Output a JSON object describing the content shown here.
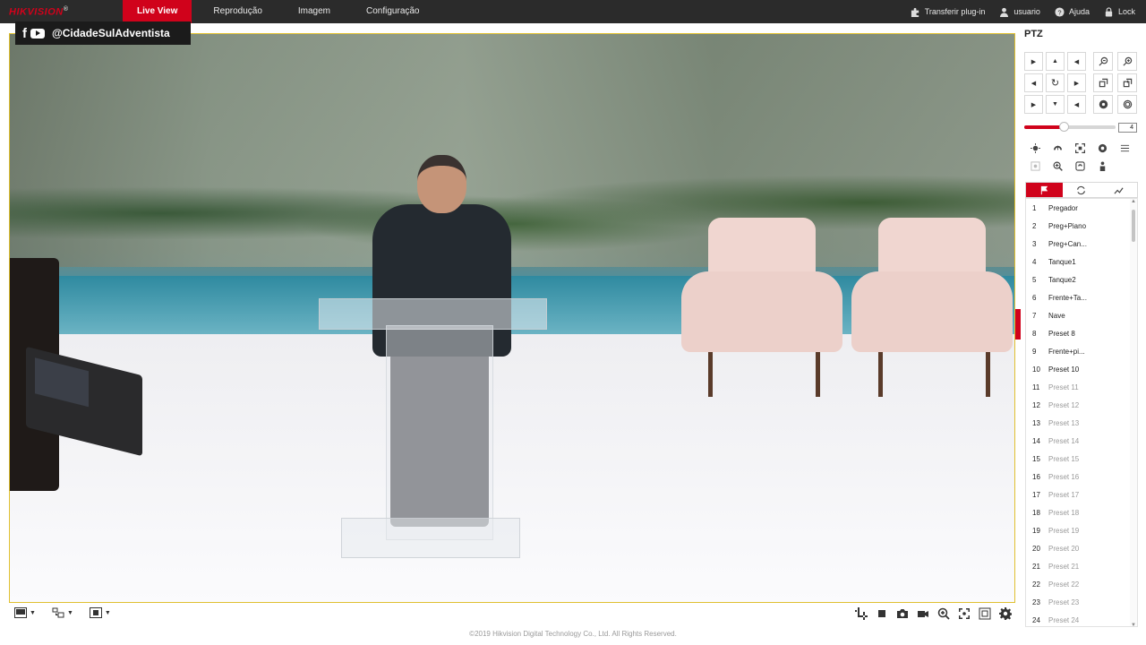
{
  "app": {
    "logo": "HIKVISION",
    "logo_mark": "®"
  },
  "nav": [
    {
      "label": "Live View",
      "active": true
    },
    {
      "label": "Reprodução",
      "active": false
    },
    {
      "label": "Imagem",
      "active": false
    },
    {
      "label": "Configuração",
      "active": false
    }
  ],
  "topbar": {
    "plugin_label": "Transferir plug-in",
    "user_label": "usuario",
    "help_label": "Ajuda",
    "lock_label": "Lock"
  },
  "overlay": {
    "social_handle": "@CidadeSulAdventista",
    "social_icons": [
      "facebook-icon",
      "youtube-icon"
    ]
  },
  "ptz": {
    "title": "PTZ",
    "speed_value": "4",
    "speed_fraction": 0.43,
    "preset_tabs": [
      "preset-flag-icon",
      "patrol-icon",
      "pattern-icon"
    ],
    "presets": [
      {
        "num": "1",
        "name": "Pregador",
        "set": true
      },
      {
        "num": "2",
        "name": "Preg+Piano",
        "set": true
      },
      {
        "num": "3",
        "name": "Preg+Can...",
        "set": true
      },
      {
        "num": "4",
        "name": "Tanque1",
        "set": true
      },
      {
        "num": "5",
        "name": "Tanque2",
        "set": true
      },
      {
        "num": "6",
        "name": "Frente+Ta...",
        "set": true
      },
      {
        "num": "7",
        "name": "Nave",
        "set": true
      },
      {
        "num": "8",
        "name": "Preset 8",
        "set": true
      },
      {
        "num": "9",
        "name": "Frente+pi...",
        "set": true
      },
      {
        "num": "10",
        "name": "Preset 10",
        "set": true
      },
      {
        "num": "11",
        "name": "Preset 11",
        "set": false
      },
      {
        "num": "12",
        "name": "Preset 12",
        "set": false
      },
      {
        "num": "13",
        "name": "Preset 13",
        "set": false
      },
      {
        "num": "14",
        "name": "Preset 14",
        "set": false
      },
      {
        "num": "15",
        "name": "Preset 15",
        "set": false
      },
      {
        "num": "16",
        "name": "Preset 16",
        "set": false
      },
      {
        "num": "17",
        "name": "Preset 17",
        "set": false
      },
      {
        "num": "18",
        "name": "Preset 18",
        "set": false
      },
      {
        "num": "19",
        "name": "Preset 19",
        "set": false
      },
      {
        "num": "20",
        "name": "Preset 20",
        "set": false
      },
      {
        "num": "21",
        "name": "Preset 21",
        "set": false
      },
      {
        "num": "22",
        "name": "Preset 22",
        "set": false
      },
      {
        "num": "23",
        "name": "Preset 23",
        "set": false
      },
      {
        "num": "24",
        "name": "Preset 24",
        "set": false
      }
    ]
  },
  "footer": {
    "copyright": "©2019 Hikvision Digital Technology Co., Ltd. All Rights Reserved."
  },
  "colors": {
    "accent": "#d0021b",
    "topbar_bg": "#2b2b2b",
    "video_border": "#e0c030"
  }
}
